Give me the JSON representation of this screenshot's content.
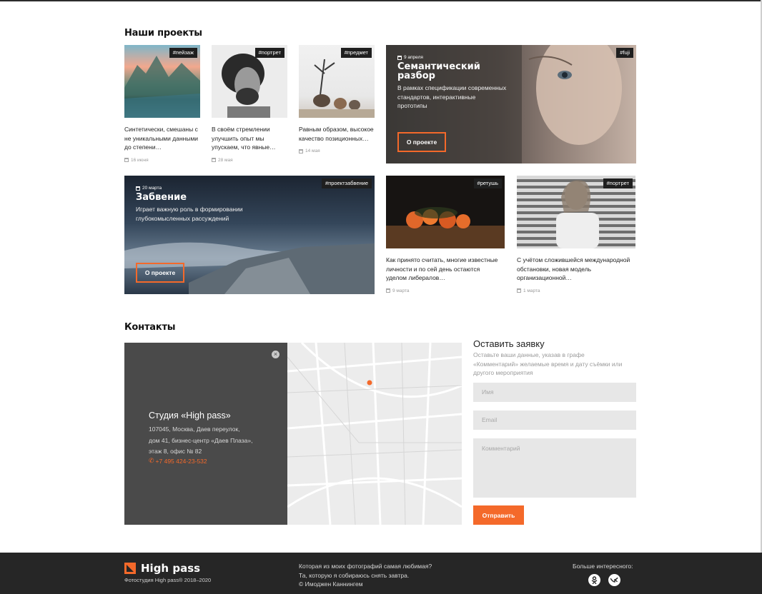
{
  "projects": {
    "title": "Наши проекты",
    "cards": [
      {
        "tag": "#пейзаж",
        "text": "Синтетически, смешаны с не уникальными данными до степени…",
        "date": "16 июня"
      },
      {
        "tag": "#портрет",
        "text": "В своём стремлении улучшить опыт мы упускаем, что явные…",
        "date": "28 мая"
      },
      {
        "tag": "#предмет",
        "text": "Равным образом, высокое качество позиционных…",
        "date": "14 мая"
      },
      {
        "tag": "#ретушь",
        "text": "Как принято считать, многие известные личности и по сей день остаются уделом либералов…",
        "date": "9 марта"
      },
      {
        "tag": "#портрет",
        "text": "С учётом сложившейся международной обстановки, новая модель организационной…",
        "date": "1 марта"
      }
    ],
    "featured": [
      {
        "tag": "#fuji",
        "date": "9 апреля",
        "title_line1": "Семантический",
        "title_line2": "разбор",
        "desc_line1": "В рамках спецификации современных",
        "desc_line2": "стандартов, интерактивные",
        "desc_line3": "прототипы",
        "button": "О проекте"
      },
      {
        "tag": "#проектзабвение",
        "date": "20 марта",
        "title_line1": "Забвение",
        "desc_line1": "Играет важную роль в формировании",
        "desc_line2": "глубокомысленных рассуждений",
        "button": "О проекте"
      }
    ]
  },
  "contacts": {
    "title": "Контакты",
    "studio": "Студия «High pass»",
    "address_line1": "107045, Москва, Даев переулок,",
    "address_line2": "дом 41, бизнес-центр «Даев Плаза»,",
    "address_line3": "этаж 8, офис № 82",
    "phone": "+7 495 424-23-532",
    "close": "×"
  },
  "form": {
    "title": "Оставить заявку",
    "desc": "Оставьте ваши данные, указав в графе «Комментарий» желаемые время и дату съёмки или другого мероприятия",
    "name_placeholder": "Имя",
    "email_placeholder": "Email",
    "comment_placeholder": "Комментарий",
    "submit": "Отправить"
  },
  "footer": {
    "brand": "High pass",
    "copyright": "Фотостудия High pass® 2018–2020",
    "quote_line1": "Которая из моих фотографий самая любимая?",
    "quote_line2": "Та, которую я собираюсь снять завтра.",
    "quote_line3": "© Имоджен Каннингем",
    "more": "Больше интересного:",
    "social1": "ok-icon",
    "social2": "vk-icon"
  },
  "colors": {
    "accent": "#f4692a",
    "footer_bg": "#262626",
    "field_bg": "#e7e7e7"
  }
}
